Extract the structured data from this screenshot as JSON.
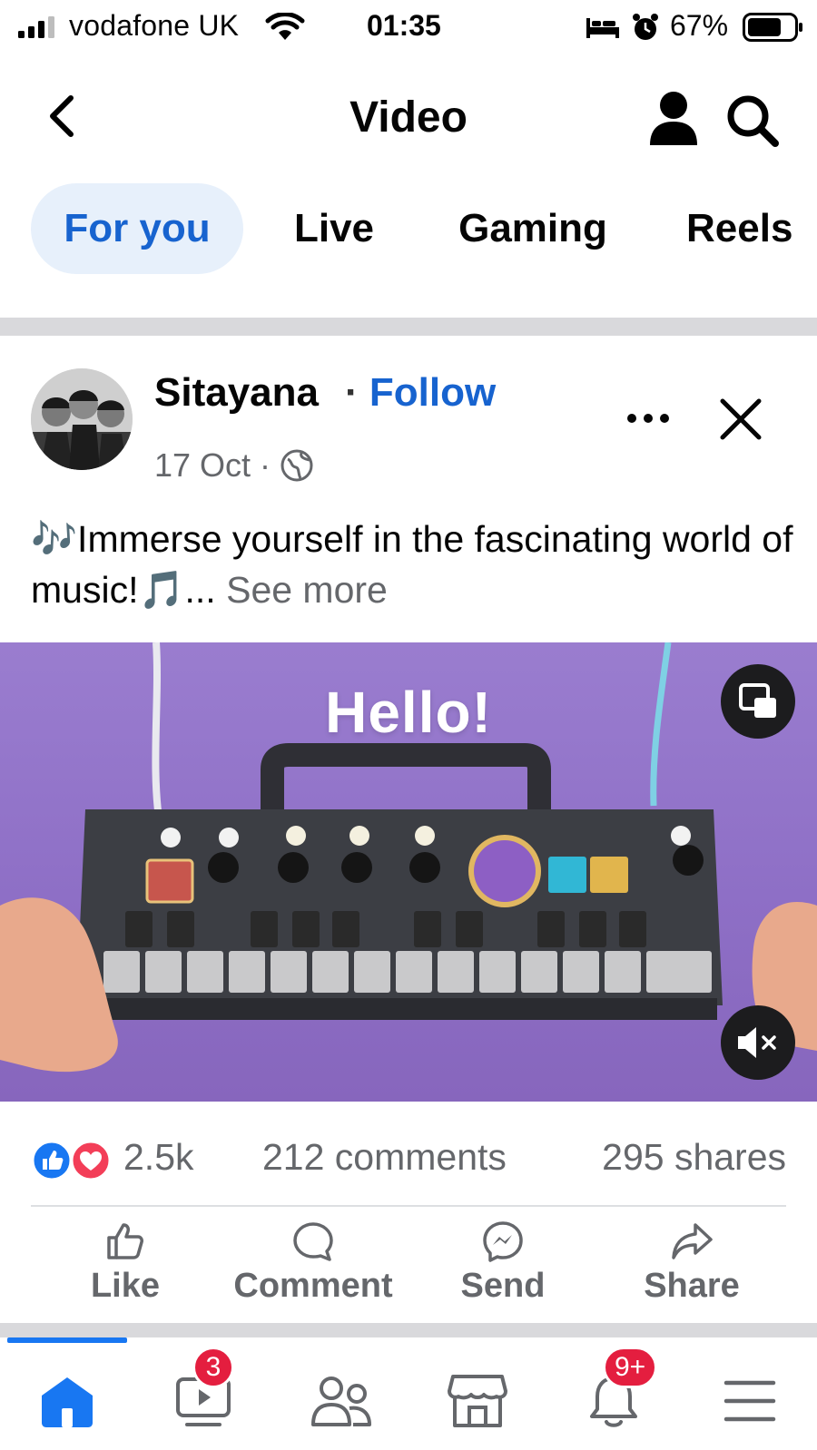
{
  "status_bar": {
    "carrier": "vodafone UK",
    "time": "01:35",
    "battery": "67%",
    "icons": [
      "signal-icon",
      "wifi-icon",
      "bed-icon",
      "alarm-icon",
      "battery-icon"
    ]
  },
  "header": {
    "title": "Video",
    "icons": [
      "back-icon",
      "profile-icon",
      "search-icon"
    ]
  },
  "tabs": [
    {
      "label": "For you",
      "active": true
    },
    {
      "label": "Live",
      "active": false
    },
    {
      "label": "Gaming",
      "active": false
    },
    {
      "label": "Reels",
      "active": false
    }
  ],
  "post": {
    "author": "Sitayana",
    "follow_separator": "·",
    "follow_label": "Follow",
    "date": "17 Oct ·",
    "caption_prefix": "🎶Immerse yourself in the fascinating world of music!🎵...",
    "see_more": "See more",
    "video_overlay_text": "Hello!",
    "reaction_count": "2.5k",
    "comments": "212 comments",
    "shares": "295 shares",
    "actions": {
      "like": "Like",
      "comment": "Comment",
      "send": "Send",
      "share": "Share"
    }
  },
  "bottom_nav": {
    "video_badge": "3",
    "notifications_badge": "9+",
    "items": [
      "home-icon",
      "video-icon",
      "friends-icon",
      "marketplace-icon",
      "notifications-icon",
      "menu-icon"
    ]
  },
  "colors": {
    "accent": "#1763cf",
    "active_tab_bg": "#e7f0fb",
    "badge": "#e41e3f",
    "video_bg": "#9a7dcf"
  }
}
